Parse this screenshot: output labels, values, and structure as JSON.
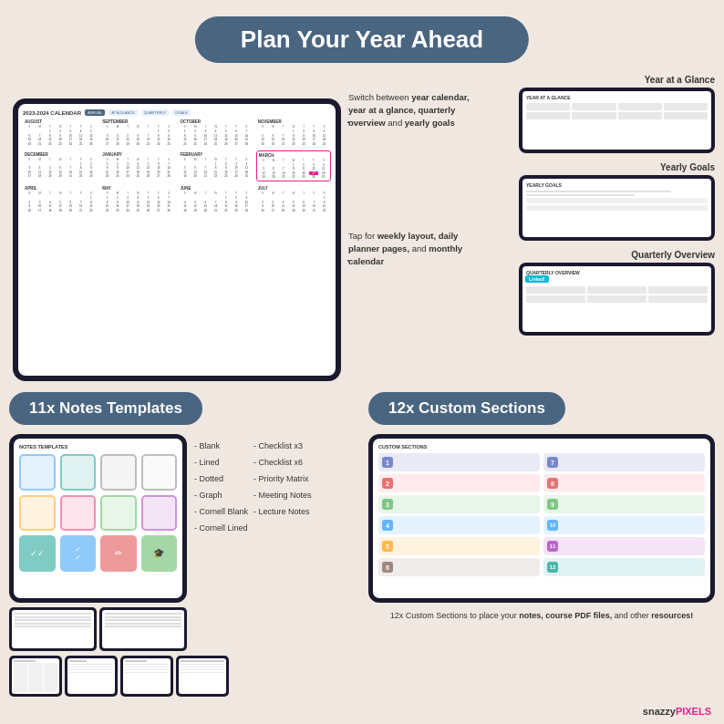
{
  "header": {
    "title": "Plan Your Year Ahead"
  },
  "top_section": {
    "annotation_top": {
      "text": "Switch between",
      "bold_items": "year calendar, year at a glance, quarterly overview and yearly goals"
    },
    "annotation_bottom": {
      "text": "Tap for",
      "bold_items": "weekly layout, daily planner pages, and monthly calendar"
    },
    "right_panels": [
      {
        "label": "Year at a Glance",
        "has_linked": false
      },
      {
        "label": "Yearly Goals",
        "has_linked": false
      },
      {
        "label": "Quarterly Overview",
        "has_linked": true
      }
    ],
    "linked_text": "Linked!",
    "calendar_header": "2023-2024 Calendar",
    "months": [
      "August",
      "September",
      "October",
      "November",
      "December",
      "January",
      "February",
      "March",
      "April",
      "May",
      "June",
      "July"
    ]
  },
  "notes_section": {
    "banner": "11x Notes Templates",
    "list_col1": [
      "- Blank",
      "- Lined",
      "- Dotted",
      "- Graph",
      "- Cornell Blank",
      "- Cornell Lined"
    ],
    "list_col2": [
      "- Checklist x3",
      "- Checklist x6",
      "- Priority Matrix",
      "- Meeting Notes",
      "- Lecture Notes"
    ]
  },
  "custom_section": {
    "banner": "12x Custom Sections",
    "description": "12x Custom Sections to place your notes, course PDF files, and other resources!",
    "numbers": [
      "1",
      "2",
      "3",
      "4",
      "5",
      "6",
      "7",
      "8",
      "9",
      "10",
      "11",
      "12"
    ],
    "colors": [
      "#7986cb",
      "#e57373",
      "#81c784",
      "#64b5f6",
      "#ffb74d",
      "#a1887f",
      "#7986cb",
      "#e57373",
      "#81c784",
      "#64b5f6",
      "#ba68c8",
      "#4db6ac"
    ]
  },
  "brand": {
    "snazzy": "snazzy",
    "pixels": "PIXELS"
  }
}
